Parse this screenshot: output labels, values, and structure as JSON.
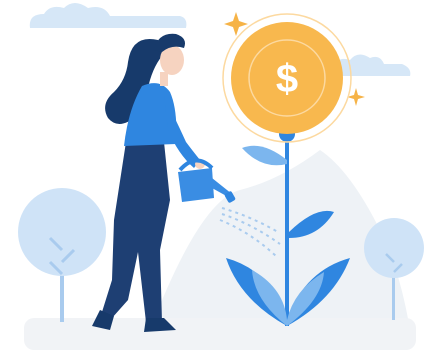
{
  "illustration": {
    "subject": "woman-watering-money-plant",
    "coin_symbol": "$",
    "colors": {
      "coin": "#F8B84E",
      "coin_inner": "#F6AE3B",
      "coin_rim": "#FCD9A0",
      "coin_symbol": "#FFFFFF",
      "sparkle": "#F6B347",
      "cloud": "#D6E7F7",
      "hill": "#EEF2F6",
      "ground": "#F1F3F6",
      "tree_light": "#CFE3F7",
      "tree_trunk": "#A9CBEE",
      "stem": "#2F86E0",
      "leaf_dark": "#2F86E0",
      "leaf_light": "#7CB6EE",
      "shirt": "#2F86E0",
      "pants": "#1E3F73",
      "hair": "#173A6B",
      "skin": "#F6D3C0",
      "shoes": "#173A6B",
      "watering_can": "#3A8DE3",
      "water": "#A9CBEE"
    }
  }
}
